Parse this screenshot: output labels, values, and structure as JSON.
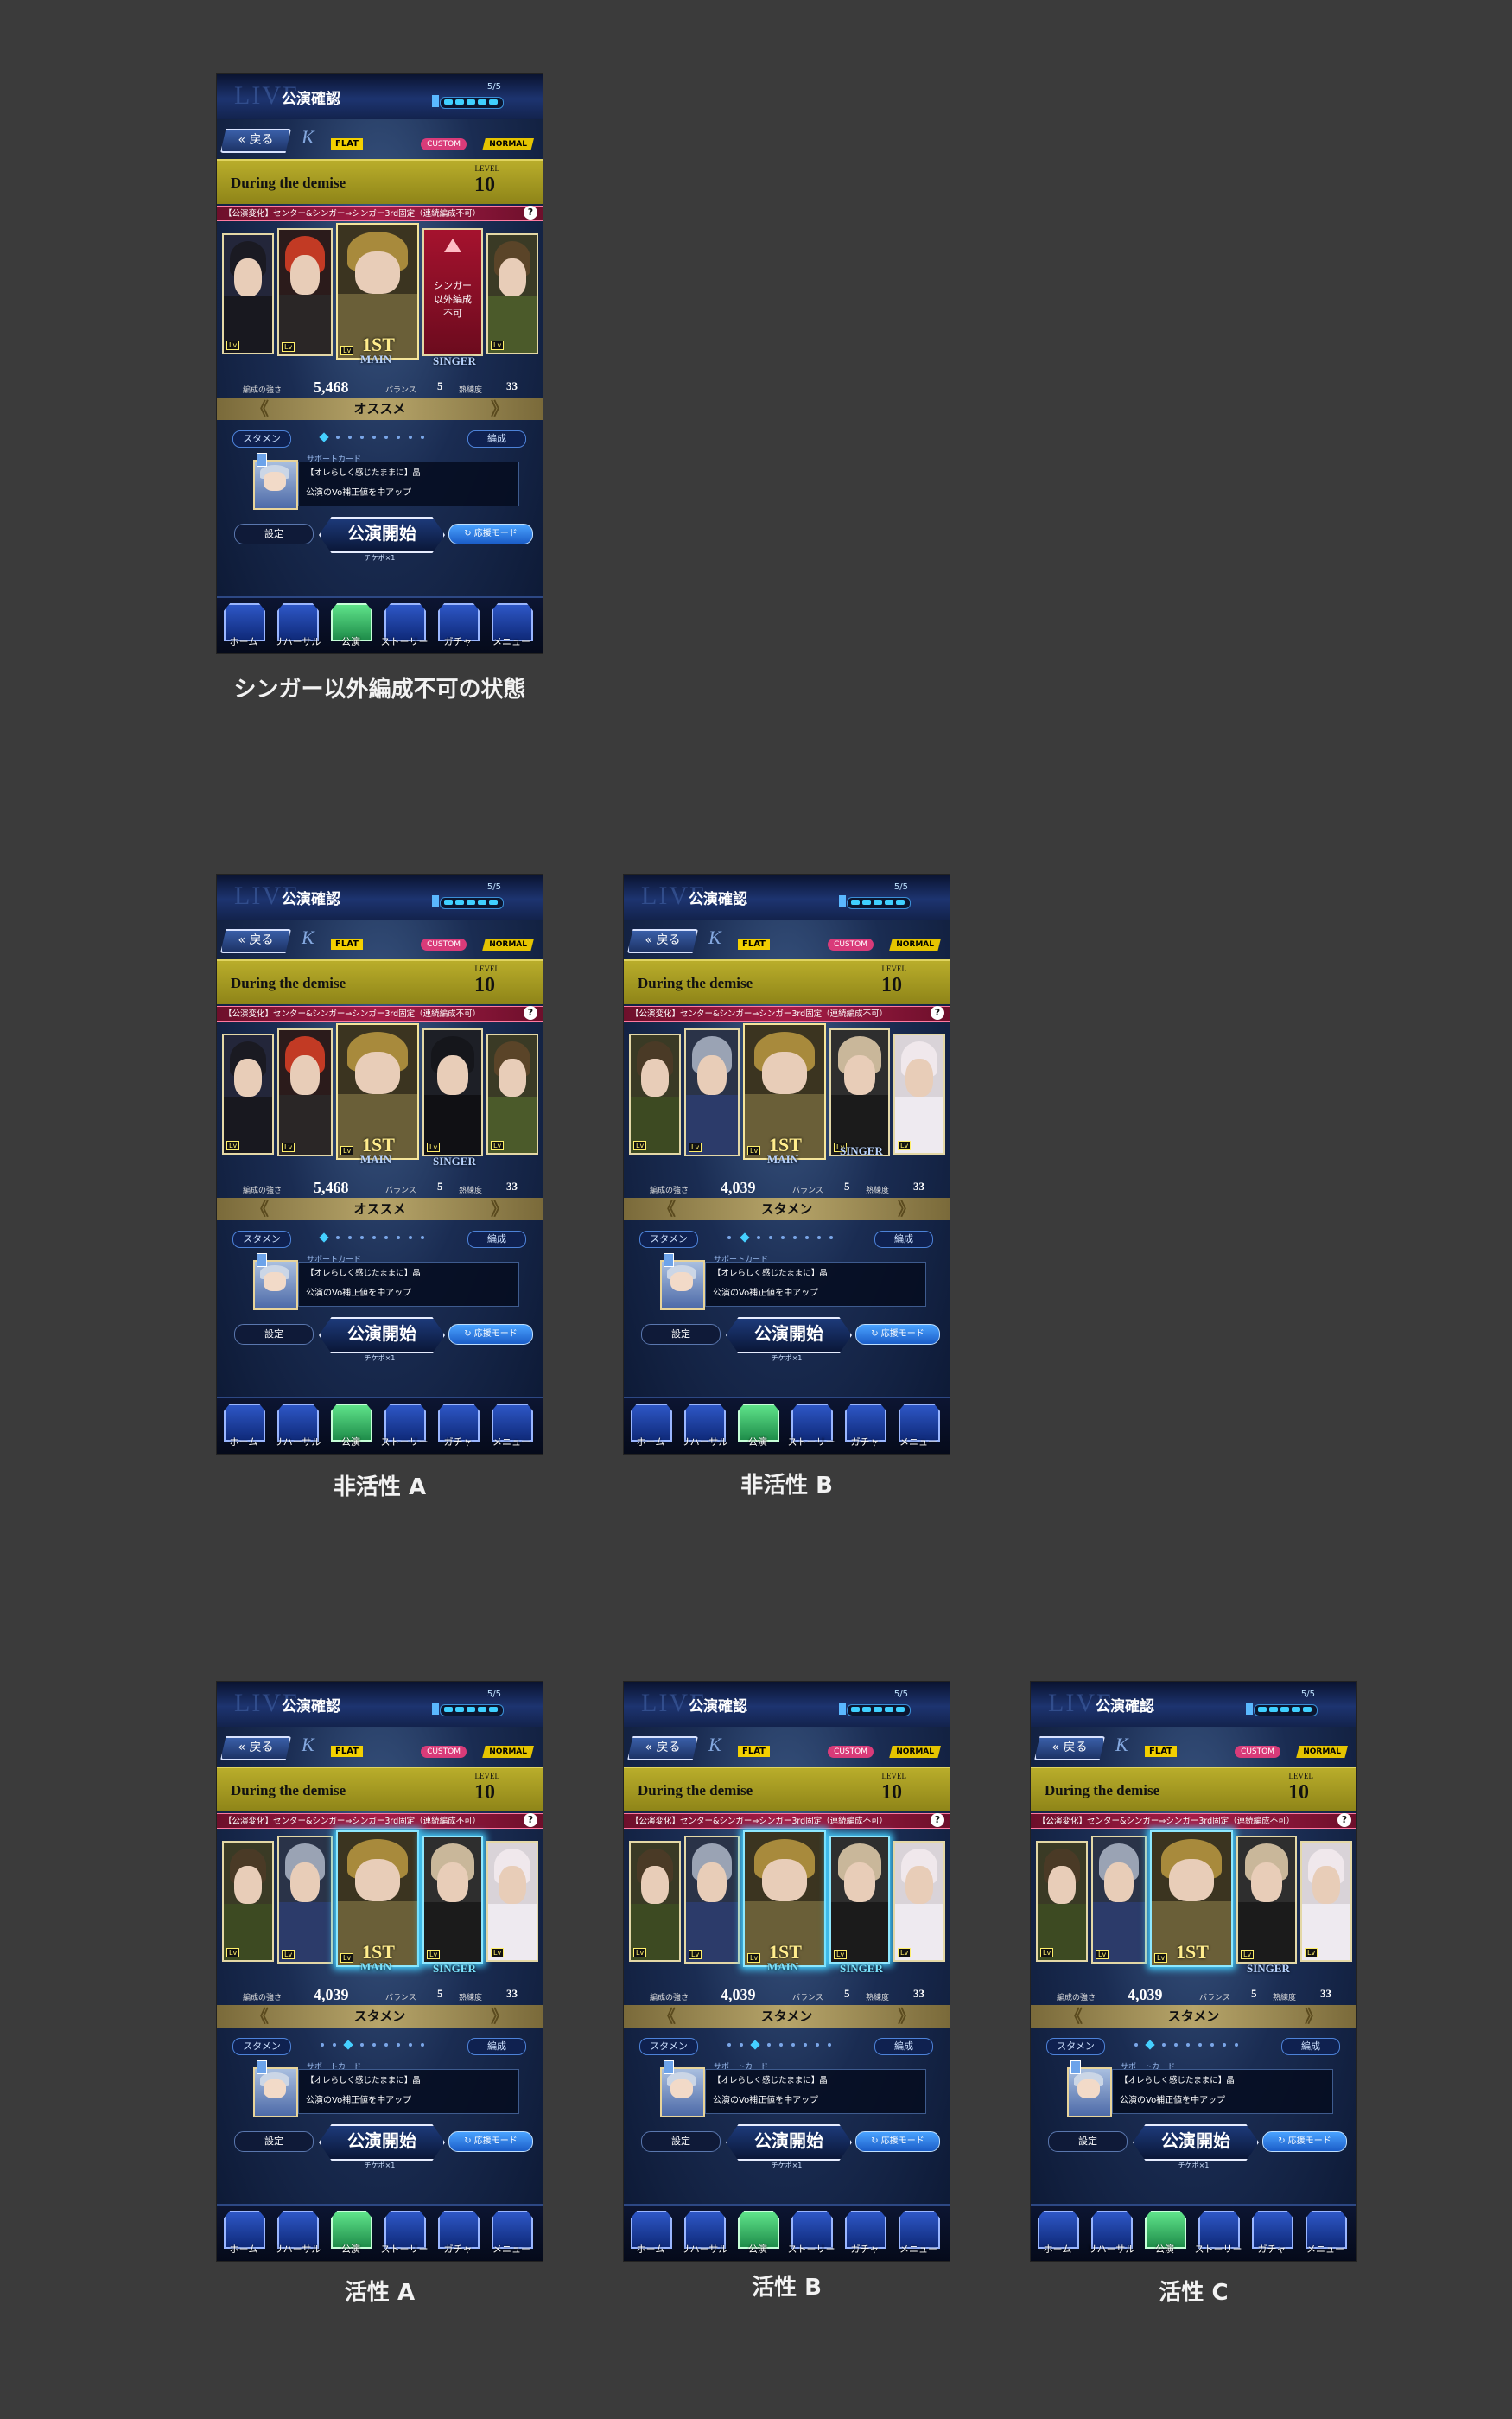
{
  "common": {
    "title": "公演確認",
    "stamina": "5/5",
    "back": "戻る",
    "flat": "FLAT",
    "custom": "CUSTOM",
    "normal": "NORMAL",
    "song": "During the demise",
    "level_label": "LEVEL",
    "level": "10",
    "notice": "【公演変化】センター&シンガー⇒シンガー3rd固定（連続編成不可）",
    "help": "?",
    "power_label": "編成の強さ",
    "balance_label": "バランス",
    "balance": "5",
    "proficiency_label": "熟練度",
    "proficiency": "33",
    "starter_pill": "スタメン",
    "edit_pill": "編成",
    "support_header": "サポートカード",
    "support_name": "【オレらしく感じたままに】晶",
    "support_effect": "公演のVo補正値を中アップ",
    "settings": "設定",
    "start": "公演開始",
    "cheer": "応援モード",
    "ticket": "チケポ×1",
    "main": "MAIN",
    "singer": "SINGER",
    "first": "1ST",
    "lock_text": "シンガー以外編成不可",
    "nav": [
      "ホーム",
      "リハーサル",
      "公演",
      "ストーリー",
      "ガチャ",
      "メニュー"
    ]
  },
  "screens": [
    {
      "caption": "シンガー以外編成不可の状態",
      "power": "5,468",
      "rec": "オススメ"
    },
    {
      "caption": "非活性 A",
      "power": "5,468",
      "rec": "オススメ"
    },
    {
      "caption": "非活性 B",
      "power": "4,039",
      "rec": "スタメン"
    },
    {
      "caption": "活性 A",
      "power": "4,039",
      "rec": "スタメン"
    },
    {
      "caption": "活性 B",
      "power": "4,039",
      "rec": "スタメン"
    },
    {
      "caption": "活性 C",
      "power": "4,039",
      "rec": "スタメン"
    }
  ],
  "colors": {
    "background": "#3b3b3b",
    "song_banner": "#b9ad2b",
    "accent": "#44d0ff",
    "notice": "#a61c46"
  }
}
